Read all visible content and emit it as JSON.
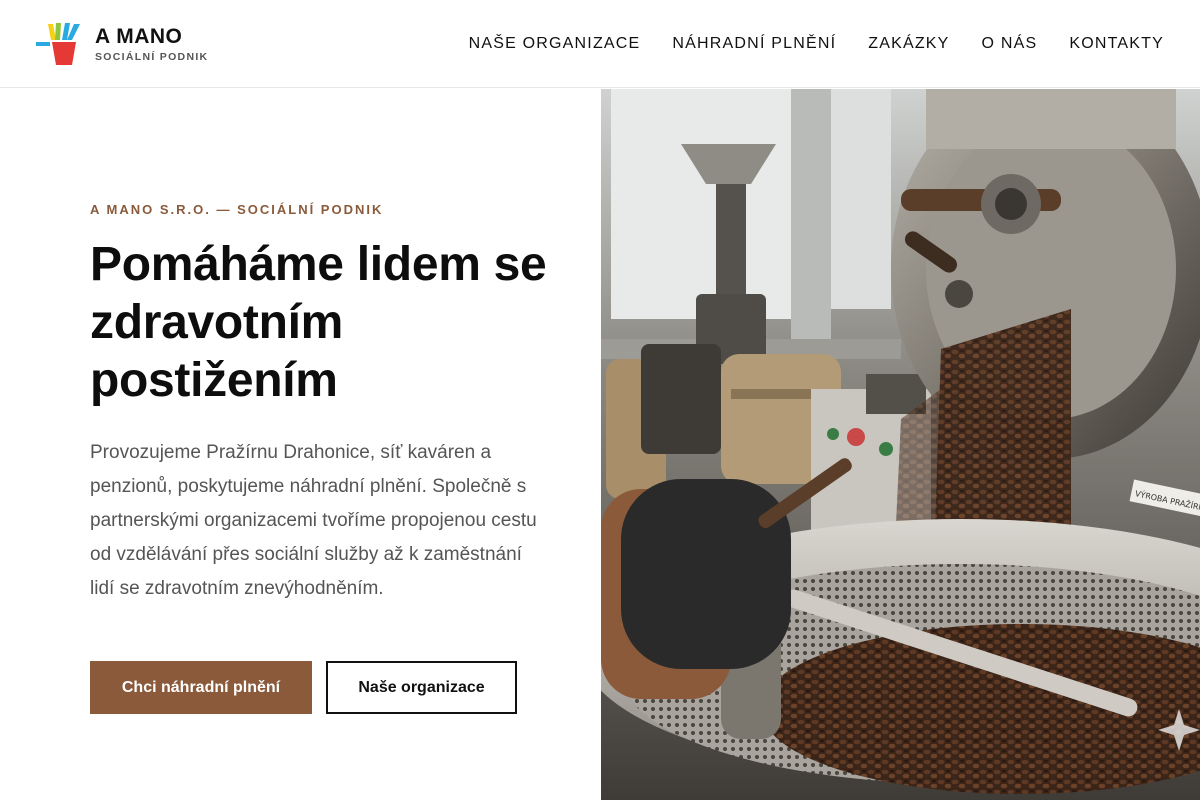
{
  "brand": {
    "name": "A MANO",
    "tagline": "SOCIÁLNÍ PODNIK",
    "logo_icon": "pencils-cup-icon",
    "colors": [
      "#f7d117",
      "#8cc63f",
      "#29abe2",
      "#e53935",
      "#e53935"
    ]
  },
  "nav": {
    "items": [
      {
        "label": "NAŠE ORGANIZACE"
      },
      {
        "label": "NÁHRADNÍ PLNĚNÍ"
      },
      {
        "label": "ZAKÁZKY"
      },
      {
        "label": "O NÁS"
      },
      {
        "label": "KONTAKTY"
      }
    ]
  },
  "hero": {
    "eyebrow": "A MANO S.R.O. — SOCIÁLNÍ PODNIK",
    "headline": "Pomáháme lidem se zdravotním postižením",
    "lead": "Provozujeme Pražírnu Drahonice, síť kaváren a penzionů, poskytujeme náhradní plnění. Společně s partnerskými organizacemi tvoříme propojenou cestu od vzdělávání přes sociální služby až k zaměstnání lidí se zdravotním znevýhodněním.",
    "primary_cta": "Chci náhradní plnění",
    "secondary_cta": "Naše organizace",
    "image_label": "VÝROBA PRAŽÍRNY · KON"
  },
  "colors": {
    "accent": "#8a5a3b",
    "text": "#0d0d0d",
    "muted": "#555555"
  }
}
